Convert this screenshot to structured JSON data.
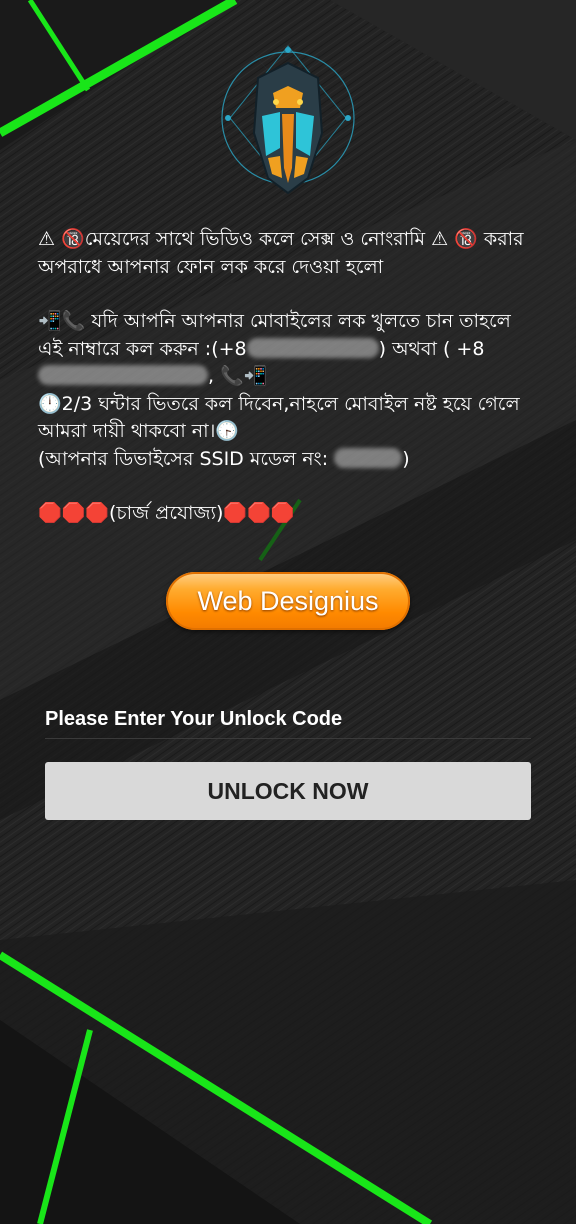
{
  "message": {
    "line1": "⚠ 🔞মেয়েদের সাথে ভিডিও কলে সেক্স ও নোংরামি ⚠ 🔞 করার অপরাধে আপনার ফোন লক করে দেওয়া হলো",
    "line2_prefix": "📲📞 যদি আপনি আপনার মোবাইলের লক খুলতে চান তাহলে এই নাম্বারে কল করুন :(+8",
    "line2_mid": ") অথবা ( +8",
    "line2_suffix": ", 📞📲",
    "line3": "🕛2/3 ঘন্টার ভিতরে কল দিবেন,নাহলে মোবাইল নষ্ট হয়ে গেলে আমরা দায়ী থাকবো না।🕞",
    "line4_prefix": "(আপনার ডিভাইসের SSID মডেল নং: ",
    "line4_suffix": ")",
    "line5": "🛑🛑🛑(চার্জ প্রযোজ্য)🛑🛑🛑"
  },
  "brand_button": {
    "label": "Web Designius"
  },
  "unlock": {
    "input_label": "Please Enter Your Unlock Code",
    "button_label": "UNLOCK NOW"
  },
  "icons": {
    "logo": "robot-warrior-logo-icon"
  },
  "colors": {
    "background": "#1e1e1e",
    "accent_green": "#19e619",
    "brand_orange": "#ff8a00",
    "unlock_button": "#d9d9d9"
  }
}
